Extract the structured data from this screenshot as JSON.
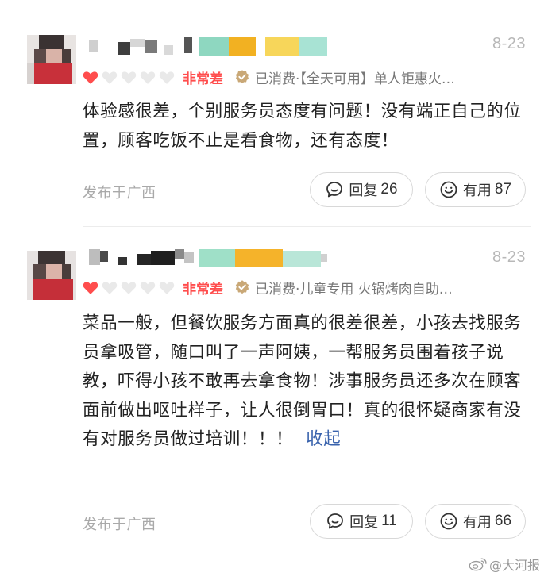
{
  "reviews": [
    {
      "date": "8-23",
      "rating_label": "非常差",
      "rating_filled": 1,
      "rating_total": 5,
      "consumed": "已消费·【全天可用】单人钜惠火…",
      "body": "体验感很差，个别服务员态度有问题！没有端正自己的位置，顾客吃饭不止是看食物，还有态度！",
      "location": "发布于广西",
      "reply_label": "回复",
      "reply_count": "26",
      "useful_label": "有用",
      "useful_count": "87"
    },
    {
      "date": "8-23",
      "rating_label": "非常差",
      "rating_filled": 1,
      "rating_total": 5,
      "consumed": "已消费·儿童专用 火锅烤肉自助…",
      "body": "菜品一般，但餐饮服务方面真的很差很差，小孩去找服务员拿吸管，随口叫了一声阿姨，一帮服务员围着孩子说教，吓得小孩不敢再去拿食物！涉事服务员还多次在顾客面前做出呕吐样子，让人很倒胃口！真的很怀疑商家有没有对服务员做过培训！！！",
      "collapse": "收起",
      "location": "发布于广西",
      "reply_label": "回复",
      "reply_count": "11",
      "useful_label": "有用",
      "useful_count": "66"
    }
  ],
  "watermark": "大河报",
  "colors": {
    "rating": "#ff4d4d",
    "heart_empty": "#e9e9e9",
    "collapse_link": "#3a63ad",
    "meta_text": "#777777"
  },
  "icons": {
    "rating": "heart-icon",
    "consumed": "verified-badge-icon",
    "reply": "comment-bubble-icon",
    "useful": "smiley-icon",
    "watermark": "weibo-icon"
  }
}
